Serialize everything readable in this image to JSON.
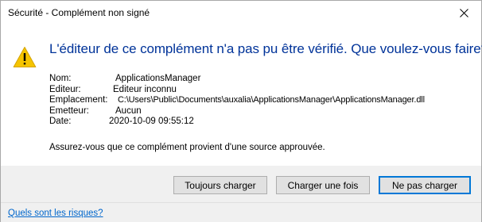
{
  "window": {
    "title": "Sécurité - Complément non signé",
    "close_icon": "close-icon"
  },
  "message": {
    "heading": "L'éditeur de ce complément n'a pas pu être vérifié. Que voulez-vous faire?",
    "icon": "warning-icon",
    "icon_color": "#f5c400"
  },
  "details": [
    {
      "label": "Nom:",
      "value": "ApplicationsManager"
    },
    {
      "label": "Editeur:",
      "value": "Editeur inconnu"
    },
    {
      "label": "Emplacement:",
      "value": "C:\\Users\\Public\\Documents\\auxalia\\ApplicationsManager\\ApplicationsManager.dll"
    },
    {
      "label": "Emetteur:",
      "value": "Aucun"
    },
    {
      "label": "Date:",
      "value": "2020-10-09 09:55:12"
    }
  ],
  "assurance": "Assurez-vous que ce complément provient d'une source approuvée.",
  "buttons": {
    "always_load": "Toujours charger",
    "load_once": "Charger une fois",
    "do_not_load": "Ne pas charger"
  },
  "footer": {
    "risks_link": "Quels sont les risques?"
  },
  "colors": {
    "heading": "#003399",
    "link": "#0066cc",
    "default_button_border": "#0078d7",
    "button_bar": "#f0f0f0"
  }
}
